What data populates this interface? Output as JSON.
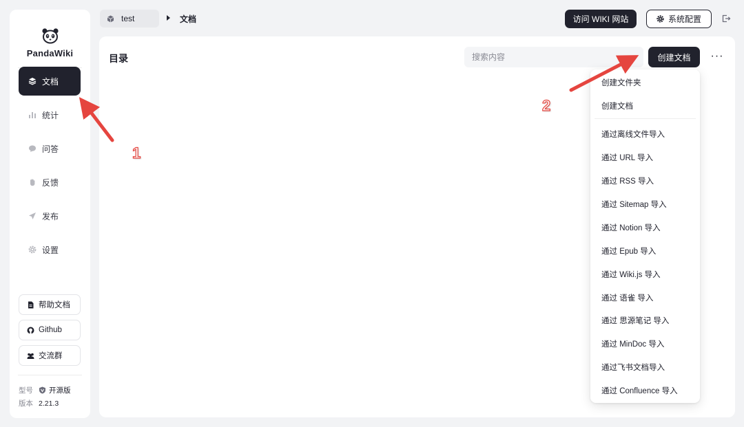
{
  "app": {
    "name": "PandaWiki"
  },
  "sidebar": {
    "items": [
      {
        "label": "文档",
        "icon": "layers-icon",
        "active": true
      },
      {
        "label": "统计",
        "icon": "bar-chart-icon",
        "active": false
      },
      {
        "label": "问答",
        "icon": "chat-bubble-icon",
        "active": false
      },
      {
        "label": "反馈",
        "icon": "hand-icon",
        "active": false
      },
      {
        "label": "发布",
        "icon": "send-icon",
        "active": false
      },
      {
        "label": "设置",
        "icon": "gear-icon",
        "active": false
      }
    ],
    "links": [
      {
        "label": "帮助文档",
        "icon": "document-icon"
      },
      {
        "label": "Github",
        "icon": "github-icon"
      },
      {
        "label": "交流群",
        "icon": "group-icon"
      }
    ],
    "meta": {
      "type_label": "型号",
      "type_value": "开源版",
      "version_label": "版本",
      "version_value": "2.21.3"
    }
  },
  "topbar": {
    "kb_name": "test",
    "current_page": "文档",
    "visit_wiki": "访问 WIKI 网站",
    "system_config": "系统配置"
  },
  "main": {
    "title": "目录",
    "search_placeholder": "搜索内容",
    "create_button": "创建文档",
    "more_label": "···"
  },
  "dropdown": {
    "items": [
      "创建文件夹",
      "创建文档",
      "通过离线文件导入",
      "通过 URL 导入",
      "通过 RSS 导入",
      "通过 Sitemap 导入",
      "通过 Notion 导入",
      "通过 Epub 导入",
      "通过 Wiki.js 导入",
      "通过 语雀 导入",
      "通过 思源笔记 导入",
      "通过 MinDoc 导入",
      "通过飞书文档导入",
      "通过 Confluence 导入"
    ]
  },
  "annotations": {
    "step1": "1",
    "step2": "2"
  },
  "colors": {
    "primary": "#21222d",
    "annotation": "#e5453f",
    "background": "#f2f3f5"
  }
}
